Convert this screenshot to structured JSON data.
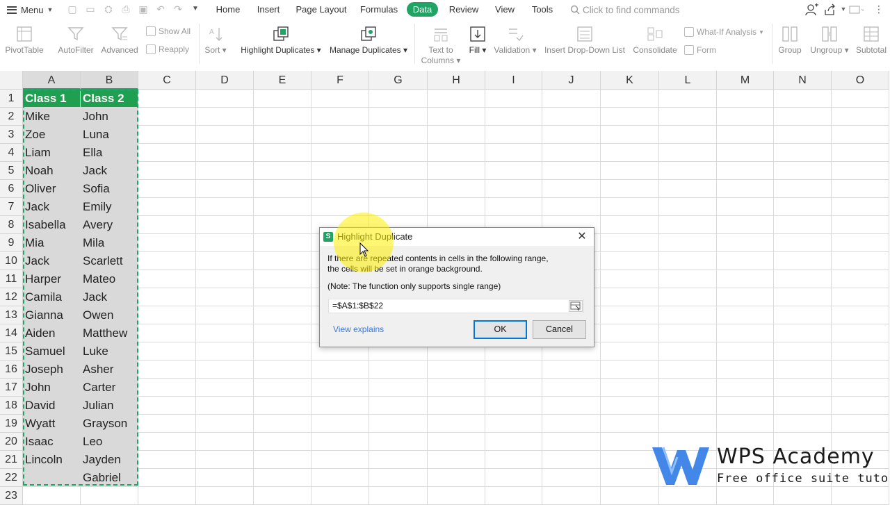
{
  "menubar": {
    "menu_label": "Menu",
    "tabs": [
      {
        "label": "Home",
        "active": false
      },
      {
        "label": "Insert",
        "active": false
      },
      {
        "label": "Page Layout",
        "active": false
      },
      {
        "label": "Formulas",
        "active": false
      },
      {
        "label": "Data",
        "active": true
      },
      {
        "label": "Review",
        "active": false
      },
      {
        "label": "View",
        "active": false
      },
      {
        "label": "Tools",
        "active": false
      }
    ],
    "search_placeholder": "Click to find commands",
    "accent_color": "#21a366"
  },
  "ribbon": {
    "pivottable": "PivotTable",
    "autofilter": "AutoFilter",
    "advanced": "Advanced",
    "show_all": "Show All",
    "reapply": "Reapply",
    "sort": "Sort",
    "highlight_duplicates": "Highlight Duplicates",
    "manage_duplicates": "Manage Duplicates",
    "text_to_columns": "Text to Columns",
    "fill": "Fill",
    "validation": "Validation",
    "insert_dropdown_list": "Insert Drop-Down List",
    "consolidate": "Consolidate",
    "what_if_analysis": "What-If Analysis",
    "form": "Form",
    "group": "Group",
    "ungroup": "Ungroup",
    "subtotal": "Subtotal"
  },
  "sheet": {
    "columns": [
      "A",
      "B",
      "C",
      "D",
      "E",
      "F",
      "G",
      "H",
      "I",
      "J",
      "K",
      "L",
      "M",
      "N",
      "O"
    ],
    "row_numbers": [
      "1",
      "2",
      "3",
      "4",
      "5",
      "6",
      "7",
      "8",
      "9",
      "10",
      "11",
      "12",
      "13",
      "14",
      "15",
      "16",
      "17",
      "18",
      "19",
      "20",
      "21",
      "22",
      "23"
    ],
    "header_fill": "#1fa050",
    "rows": [
      [
        "Class 1",
        "Class 2"
      ],
      [
        "Mike",
        "John"
      ],
      [
        "Zoe",
        "Luna"
      ],
      [
        "Liam",
        "Ella"
      ],
      [
        "Noah",
        "Jack"
      ],
      [
        "Oliver",
        "Sofia"
      ],
      [
        "Jack",
        "Emily"
      ],
      [
        "Isabella",
        "Avery"
      ],
      [
        "Mia",
        "Mila"
      ],
      [
        "Jack",
        "Scarlett"
      ],
      [
        "Harper",
        "Mateo"
      ],
      [
        "Camila",
        "Jack"
      ],
      [
        "Gianna",
        "Owen"
      ],
      [
        "Aiden",
        "Matthew"
      ],
      [
        "Samuel",
        "Luke"
      ],
      [
        "Joseph",
        "Asher"
      ],
      [
        "John",
        "Carter"
      ],
      [
        "David",
        "Julian"
      ],
      [
        "Wyatt",
        "Grayson"
      ],
      [
        "Isaac",
        "Leo"
      ],
      [
        "Lincoln",
        "Jayden"
      ],
      [
        "",
        "Gabriel"
      ],
      [
        "",
        ""
      ]
    ]
  },
  "dialog": {
    "title": "Highlight Duplicate",
    "line1": "If there are repeated contents in cells in the following range,",
    "line2": "the cells will be set in orange background.",
    "note": "(Note: The function only supports single range)",
    "range_value": "=$A$1:$B$22",
    "view_explains": "View explains",
    "ok": "OK",
    "cancel": "Cancel"
  },
  "watermark": {
    "brand": "WPS Academy",
    "tagline": "Free office suite tutorials"
  }
}
